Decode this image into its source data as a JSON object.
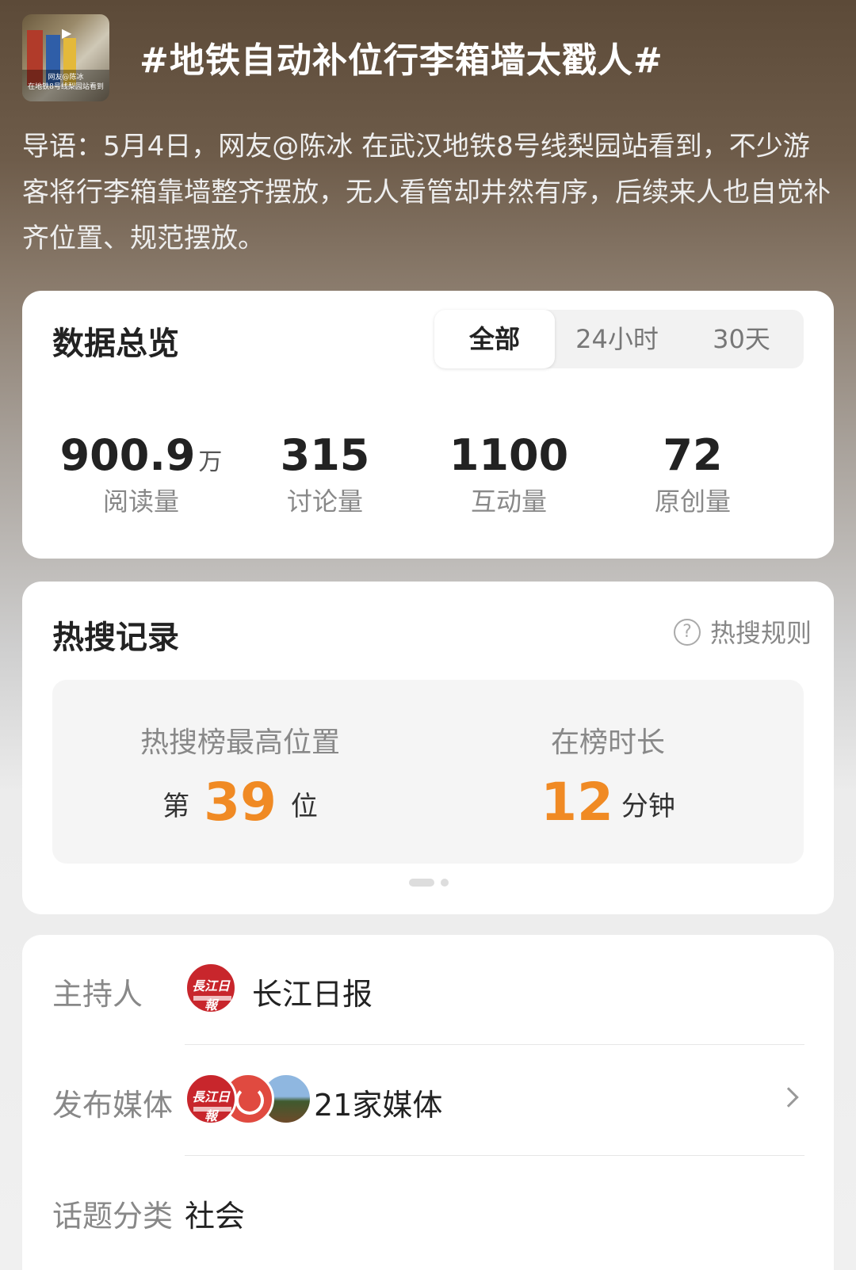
{
  "header": {
    "title": "#地铁自动补位行李箱墙太戳人#",
    "lead": "导语：5月4日，网友@陈冰 在武汉地铁8号线梨园站看到，不少游客将行李箱靠墙整齐摆放，无人看管却井然有序，后续来人也自觉补齐位置、规范摆放。",
    "thumbnail_caption_1": "网友@陈冰",
    "thumbnail_caption_2": "在地铁8号线梨园站看到",
    "thumbnail_icon": "play-icon"
  },
  "overview": {
    "title": "数据总览",
    "tabs": [
      {
        "label": "全部",
        "active": true
      },
      {
        "label": "24小时",
        "active": false
      },
      {
        "label": "30天",
        "active": false
      }
    ],
    "stats": [
      {
        "value": "900.9",
        "unit": "万",
        "label": "阅读量"
      },
      {
        "value": "315",
        "unit": "",
        "label": "讨论量"
      },
      {
        "value": "1100",
        "unit": "",
        "label": "互动量"
      },
      {
        "value": "72",
        "unit": "",
        "label": "原创量"
      }
    ]
  },
  "hot": {
    "title": "热搜记录",
    "rules_label": "热搜规则",
    "rules_icon": "question-circle-icon",
    "highest": {
      "label": "热搜榜最高位置",
      "prefix": "第",
      "value": "39",
      "suffix": "位"
    },
    "duration": {
      "label": "在榜时长",
      "value": "12",
      "suffix": "分钟"
    },
    "page_indicator": {
      "pages": 2,
      "current": 1
    }
  },
  "info": {
    "host": {
      "label": "主持人",
      "value": "长江日报",
      "logo_icon": "changjiang-daily-logo"
    },
    "media": {
      "label": "发布媒体",
      "value": "21家媒体",
      "chevron_icon": "chevron-right-icon"
    },
    "category": {
      "label": "话题分类",
      "value": "社会"
    }
  },
  "colors": {
    "accent": "#f08a24",
    "logo_red": "#c8262c"
  }
}
